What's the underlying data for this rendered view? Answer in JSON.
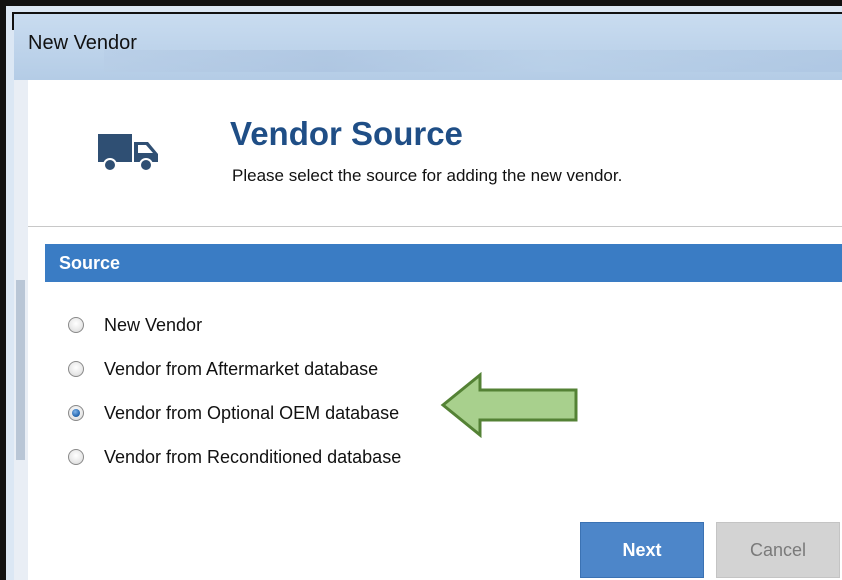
{
  "window": {
    "title": "New Vendor"
  },
  "header": {
    "icon": "truck-icon",
    "title": "Vendor Source",
    "subtitle": "Please select the source for adding the new vendor."
  },
  "section": {
    "title": "Source"
  },
  "options": [
    {
      "label": "New Vendor",
      "checked": false
    },
    {
      "label": "Vendor from Aftermarket database",
      "checked": false
    },
    {
      "label": "Vendor from Optional OEM database",
      "checked": true
    },
    {
      "label": "Vendor from Reconditioned database",
      "checked": false
    }
  ],
  "buttons": {
    "next": "Next",
    "cancel": "Cancel"
  },
  "colors": {
    "accent": "#3a7cc4",
    "heading": "#1f4e86",
    "arrow": "#a8d08d",
    "arrow_stroke": "#548235"
  }
}
